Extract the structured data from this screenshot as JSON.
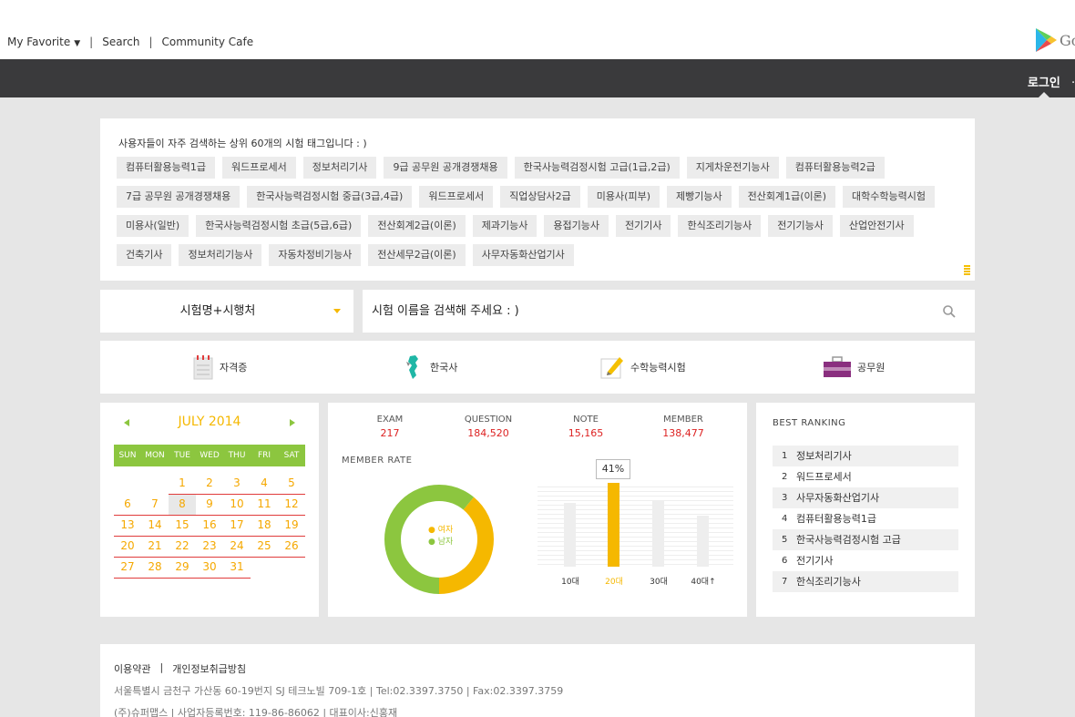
{
  "topnav": {
    "favorite": "My Favorite",
    "search": "Search",
    "community": "Community Cafe",
    "sep": "|"
  },
  "brand": {
    "partial_text": "Go"
  },
  "header": {
    "login": "로그인"
  },
  "tags": {
    "title": "사용자들이 자주 검색하는 상위 60개의 시험 태그입니다 : )",
    "items": [
      "컴퓨터활용능력1급",
      "워드프로세서",
      "정보처리기사",
      "9급 공무원 공개경쟁채용",
      "한국사능력검정시험 고급(1급,2급)",
      "지게차운전기능사",
      "컴퓨터활용능력2급",
      "7급 공무원 공개경쟁채용",
      "한국사능력검정시험 중급(3급,4급)",
      "워드프로세서",
      "직업상담사2급",
      "미용사(피부)",
      "제빵기능사",
      "전산회계1급(이론)",
      "대학수학능력시험",
      "미용사(일반)",
      "한국사능력검정시험 초급(5급,6급)",
      "전산회계2급(이론)",
      "제과기능사",
      "용접기능사",
      "전기기사",
      "한식조리기능사",
      "전기기능사",
      "산업안전기사",
      "건축기사",
      "정보처리기능사",
      "자동차정비기능사",
      "전산세무2급(이론)",
      "사무자동화산업기사"
    ]
  },
  "search": {
    "select_value": "시험명+시행처",
    "placeholder": "시험 이름을 검색해 주세요 : )"
  },
  "categories": [
    "자격증",
    "한국사",
    "수학능력시험",
    "공무원"
  ],
  "calendar": {
    "month_label": "JULY 2014",
    "weekdays": [
      "SUN",
      "MON",
      "TUE",
      "WED",
      "THU",
      "FRI",
      "SAT"
    ],
    "weeks": [
      [
        "",
        "",
        "1",
        "2",
        "3",
        "4",
        "5"
      ],
      [
        "6",
        "7",
        "8",
        "9",
        "10",
        "11",
        "12"
      ],
      [
        "13",
        "14",
        "15",
        "16",
        "17",
        "18",
        "19"
      ],
      [
        "20",
        "21",
        "22",
        "23",
        "24",
        "25",
        "26"
      ],
      [
        "27",
        "28",
        "29",
        "30",
        "31",
        "",
        ""
      ]
    ],
    "today": "8"
  },
  "stats": {
    "items": [
      {
        "label": "EXAM",
        "value": "217"
      },
      {
        "label": "QUESTION",
        "value": "184,520"
      },
      {
        "label": "NOTE",
        "value": "15,165"
      },
      {
        "label": "MEMBER",
        "value": "138,477"
      }
    ],
    "member_rate_label": "MEMBER  RATE",
    "legend_female": "● 여자",
    "legend_male": "● 남자",
    "tooltip": "41%"
  },
  "chart_data": [
    {
      "type": "pie",
      "labels": [
        "여자",
        "남자"
      ],
      "values": [
        0.39,
        0.61
      ],
      "colors": [
        "#f5b800",
        "#8cc63f"
      ]
    },
    {
      "type": "bar",
      "categories": [
        "10대",
        "20대",
        "30대",
        "40대↑"
      ],
      "values": [
        0.31,
        0.41,
        0.32,
        0.25
      ],
      "highlight": "20대",
      "colors": [
        "#eeeeee",
        "#f5b800"
      ]
    }
  ],
  "ranking": {
    "title": "BEST  RANKING",
    "items": [
      "정보처리기사",
      "워드프로세서",
      "사무자동화산업기사",
      "컴퓨터활용능력1급",
      "한국사능력검정시험 고급",
      "전기기사",
      "한식조리기능사"
    ]
  },
  "footer": {
    "terms": "이용약관",
    "privacy": "개인정보취급방침",
    "address": "서울특별시 금천구 가산동 60-19번지 SJ 테크노빌 709-1호 | Tel:02.3397.3750 | Fax:02.3397.3759",
    "corp": "(주)슈퍼맵스 | 사업자등록번호: 119-86-86062 | 대표이사:신홍재"
  },
  "colors": {
    "accent_yellow": "#f5b800",
    "accent_green": "#8cc63f",
    "dark_bar": "#3a3a3c",
    "value_red": "#dd2222"
  }
}
